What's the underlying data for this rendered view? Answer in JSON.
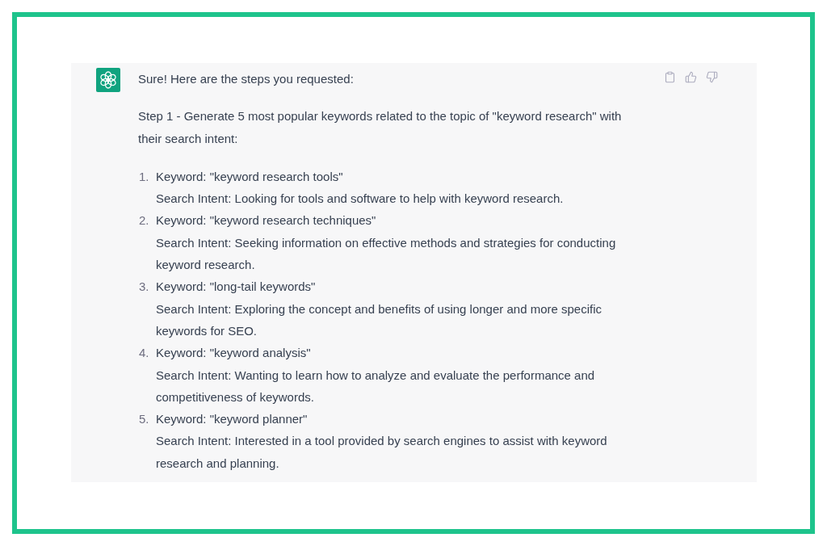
{
  "message": {
    "intro": "Sure! Here are the steps you requested:",
    "step": "Step 1 - Generate 5 most popular keywords related to the topic of \"keyword research\" with their search intent:",
    "items": [
      {
        "number": "1.",
        "keyword": "Keyword: \"keyword research tools\"",
        "intent": "Search Intent: Looking for tools and software to help with keyword research."
      },
      {
        "number": "2.",
        "keyword": "Keyword: \"keyword research techniques\"",
        "intent": "Search Intent: Seeking information on effective methods and strategies for conducting keyword research."
      },
      {
        "number": "3.",
        "keyword": "Keyword: \"long-tail keywords\"",
        "intent": "Search Intent: Exploring the concept and benefits of using longer and more specific keywords for SEO."
      },
      {
        "number": "4.",
        "keyword": "Keyword: \"keyword analysis\"",
        "intent": "Search Intent: Wanting to learn how to analyze and evaluate the performance and competitiveness of keywords."
      },
      {
        "number": "5.",
        "keyword": "Keyword: \"keyword planner\"",
        "intent": "Search Intent: Interested in a tool provided by search engines to assist with keyword research and planning."
      }
    ]
  }
}
